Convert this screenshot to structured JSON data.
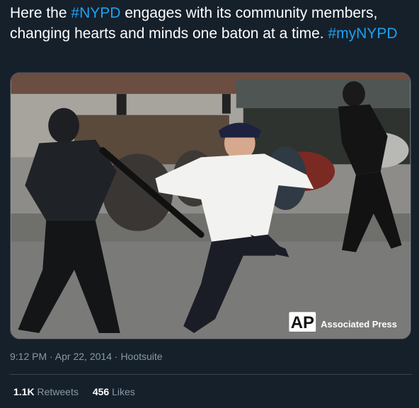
{
  "tweet": {
    "text_part1": "Here the ",
    "hashtag1": "#NYPD",
    "text_part2": " engages with its community members, changing hearts and minds one baton at a time. ",
    "hashtag2": "#myNYPD",
    "timestamp": "9:12 PM · Apr 22, 2014",
    "separator": " · ",
    "source": "Hootsuite",
    "retweets_count": "1.1K",
    "retweets_label": "Retweets",
    "likes_count": "456",
    "likes_label": "Likes"
  },
  "media": {
    "watermark_letters": "AP",
    "watermark_text": "Associated Press"
  },
  "colors": {
    "background": "#15202b",
    "hashtag": "#1da1f2",
    "muted": "#8899a6",
    "divider": "#38444d"
  }
}
